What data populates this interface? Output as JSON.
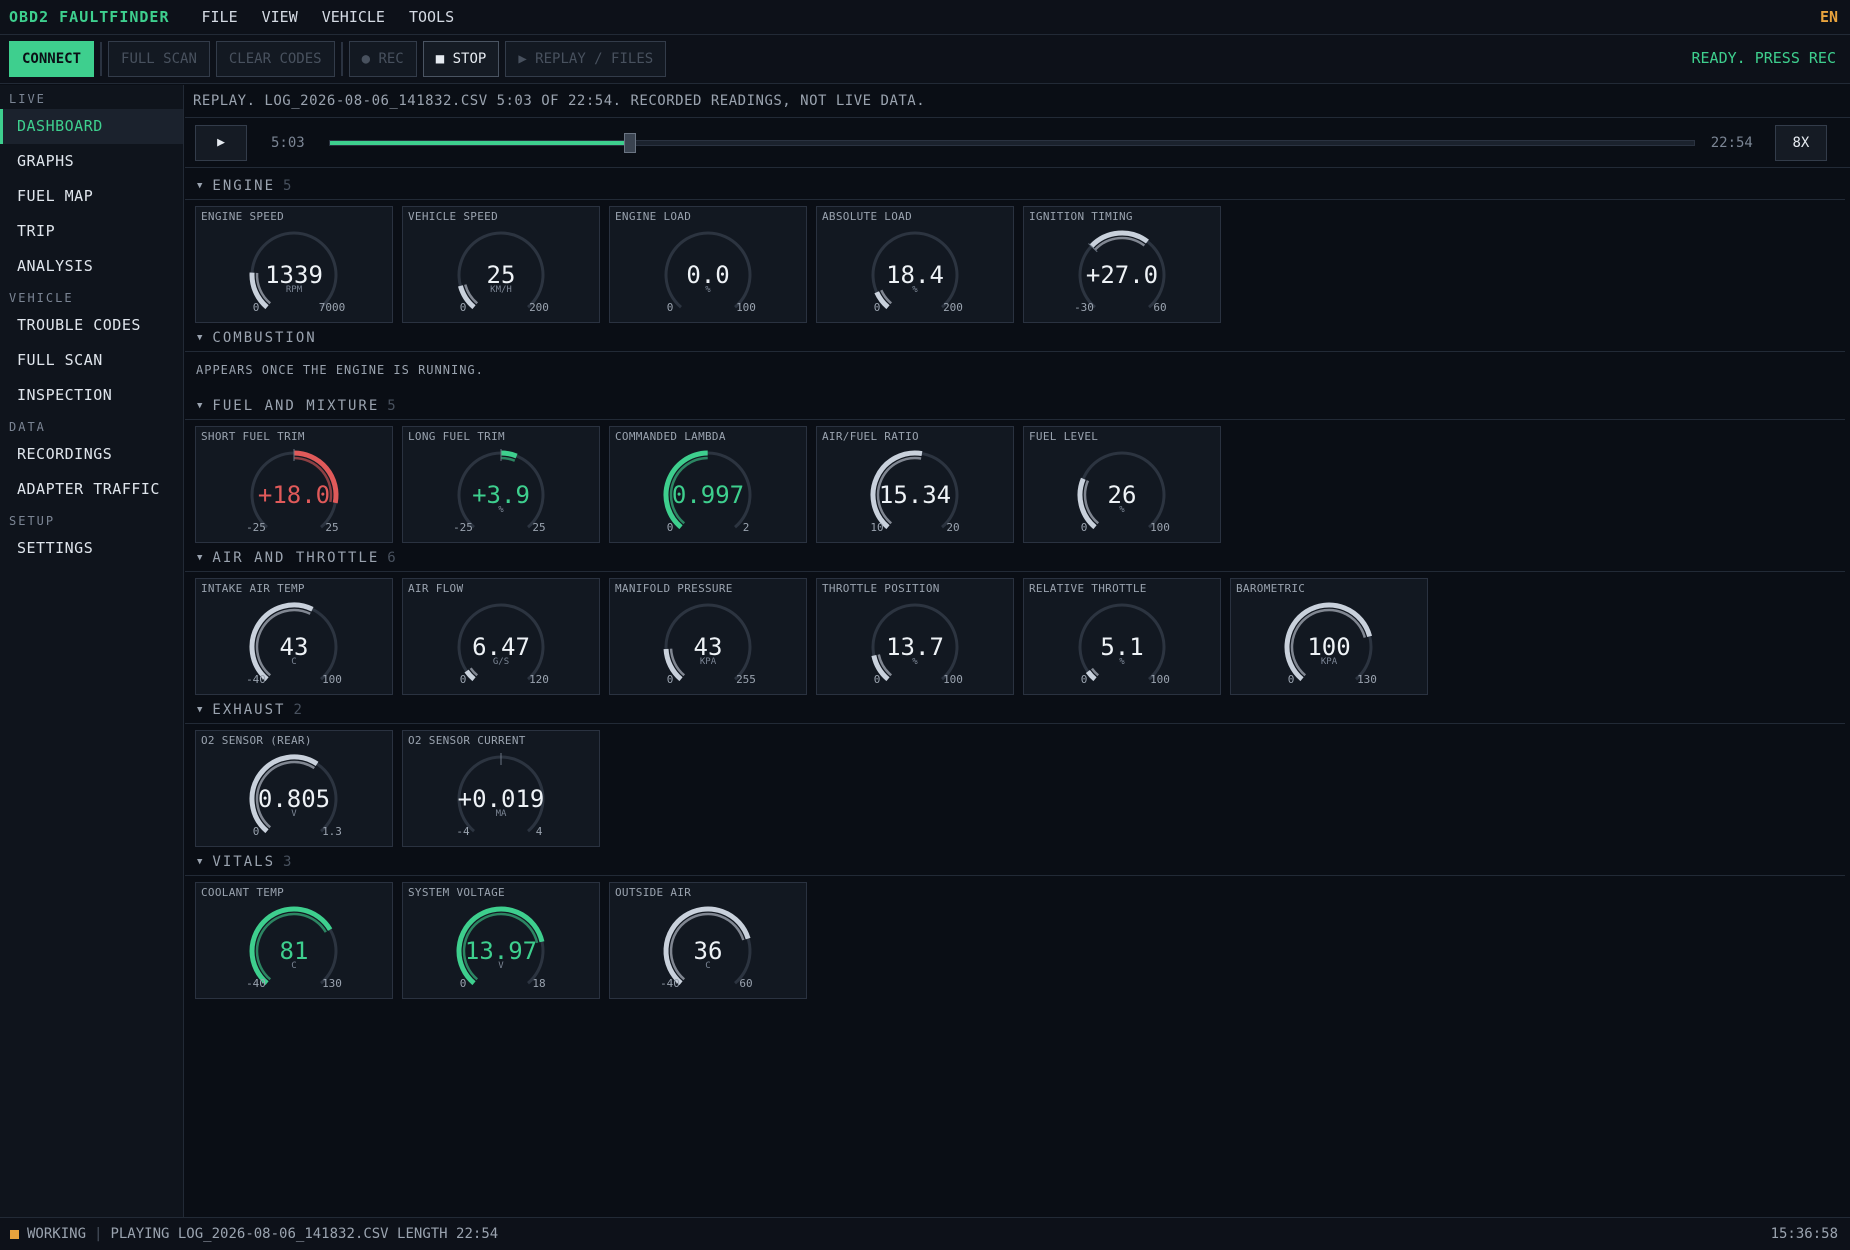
{
  "app": {
    "title": "OBD2 FAULTFINDER",
    "menu": [
      "FILE",
      "VIEW",
      "VEHICLE",
      "TOOLS"
    ],
    "lang": "EN"
  },
  "toolbar": {
    "connect": "CONNECT",
    "full_scan": "FULL SCAN",
    "clear_codes": "CLEAR CODES",
    "rec": "● REC",
    "stop": "■ STOP",
    "replay": "▶ REPLAY / FILES",
    "status": "READY. PRESS REC"
  },
  "sidebar": {
    "sections": [
      {
        "title": "LIVE",
        "items": [
          "DASHBOARD",
          "GRAPHS",
          "FUEL MAP",
          "TRIP",
          "ANALYSIS"
        ]
      },
      {
        "title": "VEHICLE",
        "items": [
          "TROUBLE CODES",
          "FULL SCAN",
          "INSPECTION"
        ]
      },
      {
        "title": "DATA",
        "items": [
          "RECORDINGS",
          "ADAPTER TRAFFIC"
        ]
      },
      {
        "title": "SETUP",
        "items": [
          "SETTINGS"
        ]
      }
    ],
    "active": "DASHBOARD"
  },
  "replay": {
    "banner": "REPLAY. LOG_2026-08-06_141832.CSV 5:03 OF 22:54. RECORDED READINGS, NOT LIVE DATA.",
    "current": "5:03",
    "total": "22:54",
    "progress": 0.22,
    "speed": "8X",
    "play_icon": "▶"
  },
  "colors": {
    "accent": "#3ecf8e",
    "warn": "#e8a33d",
    "bad": "#e05a5a",
    "neutral": "#c9d1dc"
  },
  "groups": [
    {
      "title": "ENGINE",
      "count": "5",
      "gauges": [
        {
          "label": "ENGINE SPEED",
          "value": "1339",
          "unit": "RPM",
          "min": "0",
          "max": "7000",
          "frac": 0.19,
          "color": "neutral"
        },
        {
          "label": "VEHICLE SPEED",
          "value": "25",
          "unit": "KM/H",
          "min": "0",
          "max": "200",
          "frac": 0.125,
          "color": "neutral"
        },
        {
          "label": "ENGINE LOAD",
          "value": "0.0",
          "unit": "%",
          "min": "0",
          "max": "100",
          "frac": 0,
          "color": "neutral"
        },
        {
          "label": "ABSOLUTE LOAD",
          "value": "18.4",
          "unit": "%",
          "min": "0",
          "max": "200",
          "frac": 0.092,
          "color": "neutral"
        },
        {
          "label": "IGNITION TIMING",
          "value": "+27.0",
          "unit": "",
          "min": "-30",
          "max": "60",
          "frac": 0.633,
          "center": 0.333,
          "color": "neutral"
        }
      ]
    },
    {
      "title": "COMBUSTION",
      "count": "",
      "empty": "APPEARS ONCE THE ENGINE IS RUNNING.",
      "gauges": []
    },
    {
      "title": "FUEL AND MIXTURE",
      "count": "5",
      "gauges": [
        {
          "label": "SHORT FUEL TRIM",
          "value": "+18.0",
          "unit": "",
          "min": "-25",
          "max": "25",
          "frac": 0.86,
          "center": 0.5,
          "color": "bad"
        },
        {
          "label": "LONG FUEL TRIM",
          "value": "+3.9",
          "unit": "%",
          "min": "-25",
          "max": "25",
          "frac": 0.578,
          "center": 0.5,
          "color": "accent"
        },
        {
          "label": "COMMANDED LAMBDA",
          "value": "0.997",
          "unit": "",
          "min": "0",
          "max": "2",
          "frac": 0.4985,
          "color": "accent"
        },
        {
          "label": "AIR/FUEL RATIO",
          "value": "15.34",
          "unit": "",
          "min": "10",
          "max": "20",
          "frac": 0.534,
          "color": "neutral"
        },
        {
          "label": "FUEL LEVEL",
          "value": "26",
          "unit": "%",
          "min": "0",
          "max": "100",
          "frac": 0.26,
          "color": "neutral"
        }
      ]
    },
    {
      "title": "AIR AND THROTTLE",
      "count": "6",
      "gauges": [
        {
          "label": "INTAKE AIR TEMP",
          "value": "43",
          "unit": "C",
          "min": "-40",
          "max": "100",
          "frac": 0.593,
          "color": "neutral"
        },
        {
          "label": "AIR FLOW",
          "value": "6.47",
          "unit": "G/S",
          "min": "0",
          "max": "120",
          "frac": 0.054,
          "color": "neutral"
        },
        {
          "label": "MANIFOLD PRESSURE",
          "value": "43",
          "unit": "KPA",
          "min": "0",
          "max": "255",
          "frac": 0.169,
          "color": "neutral"
        },
        {
          "label": "THROTTLE POSITION",
          "value": "13.7",
          "unit": "%",
          "min": "0",
          "max": "100",
          "frac": 0.137,
          "color": "neutral"
        },
        {
          "label": "RELATIVE THROTTLE",
          "value": "5.1",
          "unit": "%",
          "min": "0",
          "max": "100",
          "frac": 0.051,
          "color": "neutral"
        },
        {
          "label": "BAROMETRIC",
          "value": "100",
          "unit": "KPA",
          "min": "0",
          "max": "130",
          "frac": 0.769,
          "color": "neutral"
        }
      ]
    },
    {
      "title": "EXHAUST",
      "count": "2",
      "gauges": [
        {
          "label": "O2 SENSOR (REAR)",
          "value": "0.805",
          "unit": "V",
          "min": "0",
          "max": "1.3",
          "frac": 0.619,
          "color": "neutral"
        },
        {
          "label": "O2 SENSOR CURRENT",
          "value": "+0.019",
          "unit": "MA",
          "min": "-4",
          "max": "4",
          "frac": 0.502,
          "center": 0.5,
          "color": "neutral"
        }
      ]
    },
    {
      "title": "VITALS",
      "count": "3",
      "gauges": [
        {
          "label": "COOLANT TEMP",
          "value": "81",
          "unit": "C",
          "min": "-40",
          "max": "130",
          "frac": 0.712,
          "color": "accent"
        },
        {
          "label": "SYSTEM VOLTAGE",
          "value": "13.97",
          "unit": "V",
          "min": "0",
          "max": "18",
          "frac": 0.776,
          "color": "accent"
        },
        {
          "label": "OUTSIDE AIR",
          "value": "36",
          "unit": "C",
          "min": "-40",
          "max": "60",
          "frac": 0.76,
          "color": "neutral"
        }
      ]
    }
  ],
  "statusbar": {
    "state": "WORKING",
    "message": "PLAYING LOG_2026-08-06_141832.CSV LENGTH 22:54",
    "clock": "15:36:58"
  }
}
